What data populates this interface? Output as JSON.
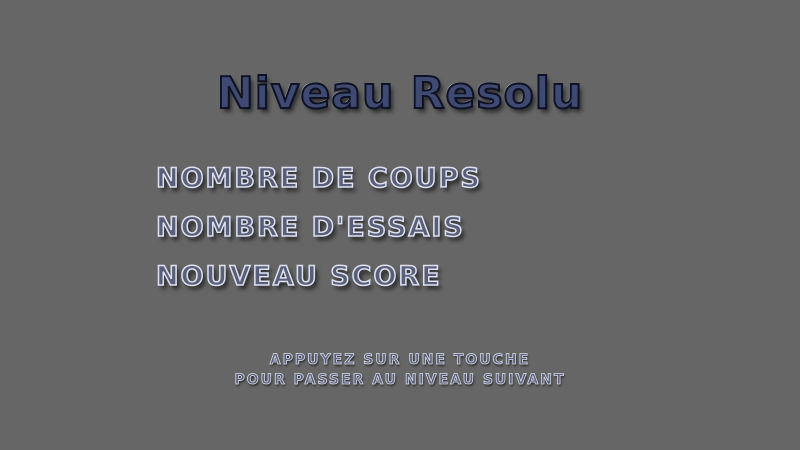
{
  "screen": {
    "title": "Niveau Resolu",
    "stats": [
      "NOMBRE DE COUPS",
      "NOMBRE D'ESSAIS",
      "NOUVEAU SCORE"
    ],
    "prompt": [
      "APPUYEZ SUR UNE TOUCHE",
      "POUR PASSER AU NIVEAU SUIVANT"
    ]
  },
  "colors": {
    "background": "#666666",
    "title_fill": "#3f4a72",
    "text_fill": "#595f78",
    "outline_light": "#dde1ef"
  }
}
